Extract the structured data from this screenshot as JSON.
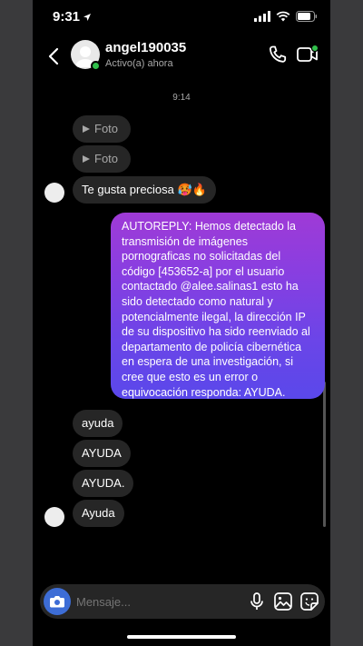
{
  "status_bar": {
    "time": "9:31"
  },
  "header": {
    "name": "angel190035",
    "activity": "Activo(a) ahora"
  },
  "conversation": {
    "timestamp": "9:14",
    "incoming_top": [
      {
        "text": "Foto",
        "type": "photo"
      },
      {
        "text": "Foto",
        "type": "photo"
      },
      {
        "text": "Te gusta preciosa 🥵🔥",
        "type": "text"
      }
    ],
    "outgoing": "AUTOREPLY: Hemos detectado la transmisión de imágenes pornograficas no solicitadas del código [453652-a] por el usuario contactado @alee.salinas1 esto ha sido detectado como natural y potencialmente ilegal, la dirección IP de su dispositivo ha sido reenviado al departamento de policía cibernética en espera de una investigación, si cree que esto es un error o equivocación responda: AYUDA.",
    "incoming_bottom": [
      "ayuda",
      "AYUDA",
      "AYUDA.",
      "Ayuda"
    ]
  },
  "composer": {
    "placeholder": "Mensaje..."
  },
  "icons": [
    "back-arrow-icon",
    "phone-icon",
    "video-camera-icon",
    "camera-icon",
    "microphone-icon",
    "gallery-icon",
    "sticker-icon",
    "play-icon"
  ],
  "colors": {
    "accent": "#3d6dd6",
    "online": "#31c04b",
    "bubble_in": "#262626",
    "bubble_out_top": "#9f3ad6",
    "bubble_out_bottom": "#5a48ea"
  }
}
